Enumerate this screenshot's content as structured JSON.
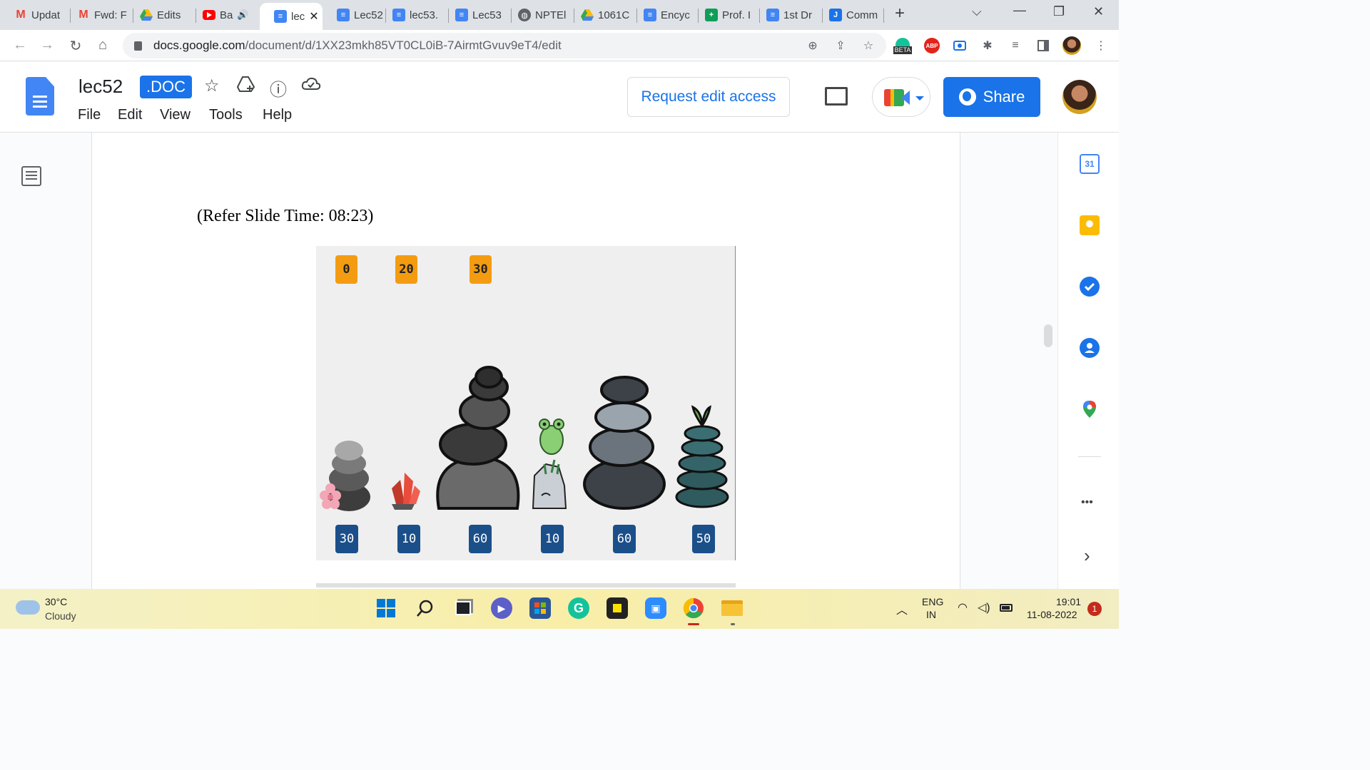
{
  "browser": {
    "tabs": [
      {
        "label": "Updat",
        "icon": "gmail-icon"
      },
      {
        "label": "Fwd: F",
        "icon": "gmail-icon"
      },
      {
        "label": "Edits",
        "icon": "drive-icon"
      },
      {
        "label": "Ba",
        "icon": "youtube-icon"
      },
      {
        "label": "lec",
        "icon": "docs-icon"
      },
      {
        "label": "Lec52",
        "icon": "docs-icon"
      },
      {
        "label": "lec53.",
        "icon": "docs-icon"
      },
      {
        "label": "Lec53",
        "icon": "docs-icon"
      },
      {
        "label": "NPTEl",
        "icon": "globe-icon"
      },
      {
        "label": "1061C",
        "icon": "drive-icon"
      },
      {
        "label": "Encyc",
        "icon": "docs-icon"
      },
      {
        "label": "Prof. I",
        "icon": "sheets-icon"
      },
      {
        "label": "1st Dr",
        "icon": "docs-icon"
      },
      {
        "label": "Comm",
        "icon": "j-icon"
      }
    ],
    "new_tab": "+",
    "url_host": "docs.google.com",
    "url_path": "/document/d/1XX23mkh85VT0CL0iB-7AirmtGvuv9eT4/edit",
    "ext_beta": "BETA",
    "ext_abp": "ABP"
  },
  "docs": {
    "title": "lec52",
    "badge": ".DOC",
    "menu": [
      "File",
      "Edit",
      "View",
      "Tools",
      "Help"
    ],
    "request_access": "Request edit access",
    "share": "Share"
  },
  "document": {
    "refer_text": "(Refer Slide Time: 08:23)",
    "slide": {
      "top_tags": [
        "0",
        "20",
        "30"
      ],
      "bottom_tags": [
        "30",
        "10",
        "60",
        "10",
        "60",
        "50"
      ]
    }
  },
  "side_panel": {
    "calendar_day": "31",
    "more": "•••",
    "expand": "›"
  },
  "taskbar": {
    "weather_temp": "30°C",
    "weather_desc": "Cloudy",
    "lang": "ENG",
    "region": "IN",
    "time": "19:01",
    "date": "11-08-2022",
    "notif_count": "1"
  },
  "colors": {
    "accent": "#1a73e8",
    "orange_tag": "#f39c12",
    "blue_tag": "#1b4f8a"
  }
}
